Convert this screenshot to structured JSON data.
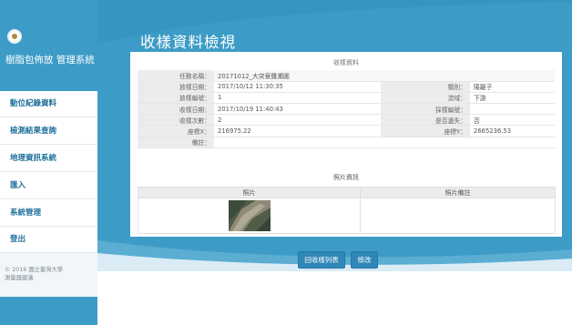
{
  "sidebar": {
    "system_name": "樹脂包佈放 管理系統",
    "items": [
      {
        "label": "動位紀錄資料"
      },
      {
        "label": "檢測結果查詢"
      },
      {
        "label": "地理資訊系統"
      },
      {
        "label": "匯入"
      },
      {
        "label": "系統管理"
      },
      {
        "label": "登出"
      }
    ],
    "footer_line1": "© 2016 國立臺灣大學",
    "footer_line2": "測量器建議"
  },
  "page": {
    "title": "收樣資料檢視",
    "section_sampling": "收樣資料",
    "section_photo": "照片資訊"
  },
  "fields": {
    "task_name_label": "任務名稱：",
    "task_name": "20171012_大突寮雞瀬圖",
    "deploy_date_label": "放樣日期：",
    "deploy_date": "2017/10/12 11:30:35",
    "type_label": "類別：",
    "type": "陽離子",
    "deploy_no_label": "放樣編號：",
    "deploy_no": "1",
    "stream_label": "流域：",
    "stream": "下游",
    "collect_date_label": "收樣日期：",
    "collect_date": "2017/10/19 11:40:43",
    "sample_no_label": "採樣編號：",
    "sample_no": "",
    "collect_count_label": "收樣次數：",
    "collect_count": "2",
    "lost_label": "是否遺失：",
    "lost": "否",
    "x_label": "座標X：",
    "x": "216975.22",
    "y_label": "座標Y：",
    "y": "2665236.53",
    "remark_label": "備註：",
    "remark": ""
  },
  "photo_table": {
    "col_photo": "照片",
    "col_remark": "照片備註",
    "rows": [
      {
        "remark": ""
      }
    ]
  },
  "buttons": {
    "back": "回收樣列表",
    "edit": "修改"
  },
  "colors": {
    "brand_blue": "#3d9cc7",
    "button_blue": "#2e87b7"
  }
}
